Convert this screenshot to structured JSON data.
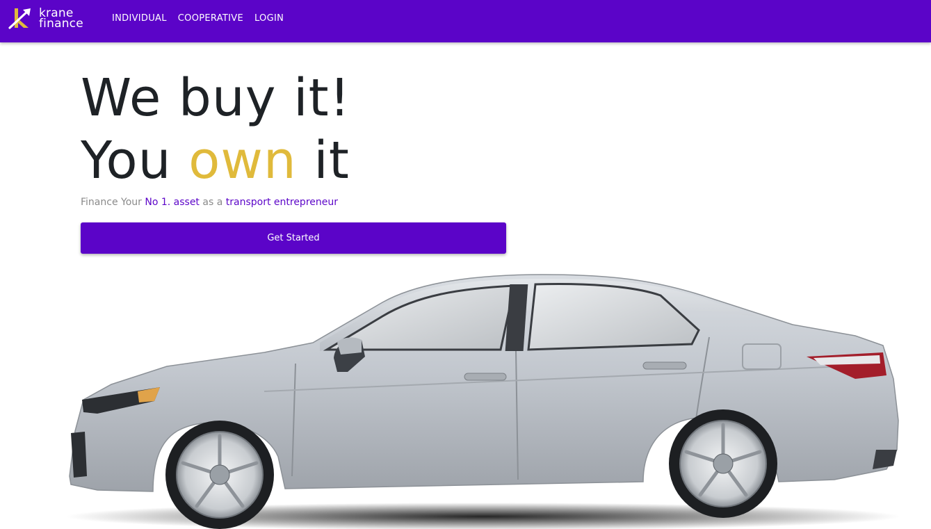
{
  "nav": {
    "brand_line1": "krane",
    "brand_line2": "finance",
    "links": [
      "INDIVIDUAL",
      "COOPERATIVE",
      "LOGIN"
    ]
  },
  "hero": {
    "line1": "We buy it!",
    "line2_start": "You ",
    "line2_accent": "own",
    "line2_end": " it",
    "tagline_part1": "Finance Your ",
    "tagline_hl1": "No 1. asset",
    "tagline_part2": " as a ",
    "tagline_hl2": "transport entrepreneur",
    "cta_label": "Get Started"
  },
  "colors": {
    "brand_purple": "#5b04c8",
    "accent_gold": "#e0ba3b",
    "heading_dark": "#1e2226"
  },
  "icons": {
    "logo": "krane-k-logo-icon",
    "car": "silver-sedan-image"
  }
}
